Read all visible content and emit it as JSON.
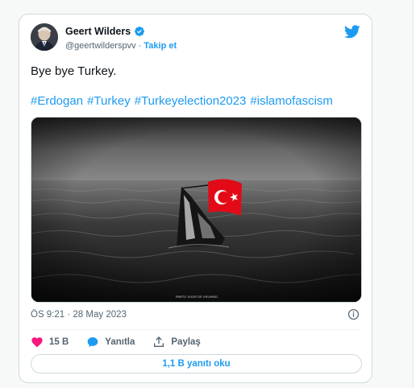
{
  "tweet": {
    "author_name": "Geert Wilders",
    "handle": "@geertwilderspvv",
    "separator": "·",
    "follow_label": "Takip et",
    "text": "Bye bye Turkey.",
    "hashtags": [
      "#Erdogan",
      "#Turkey",
      "#Turkeyelection2023",
      "#islamofascism"
    ],
    "timestamp": "ÖS 9:21 · 28 May 2023",
    "media_caption": "PARTIJ VOOR DE VRIJHEID"
  },
  "actions": {
    "like_count": "15 B",
    "reply_label": "Yanıtla",
    "share_label": "Paylaş"
  },
  "read_replies_label": "1,1 B yanıtı oku",
  "colors": {
    "accent": "#1d9bf0",
    "like": "#f91880",
    "text_secondary": "#536471",
    "flag_red": "#e30a17"
  },
  "icons": [
    "verified-badge-icon",
    "twitter-bird-icon",
    "info-icon",
    "heart-icon",
    "reply-bubble-icon",
    "share-icon"
  ]
}
